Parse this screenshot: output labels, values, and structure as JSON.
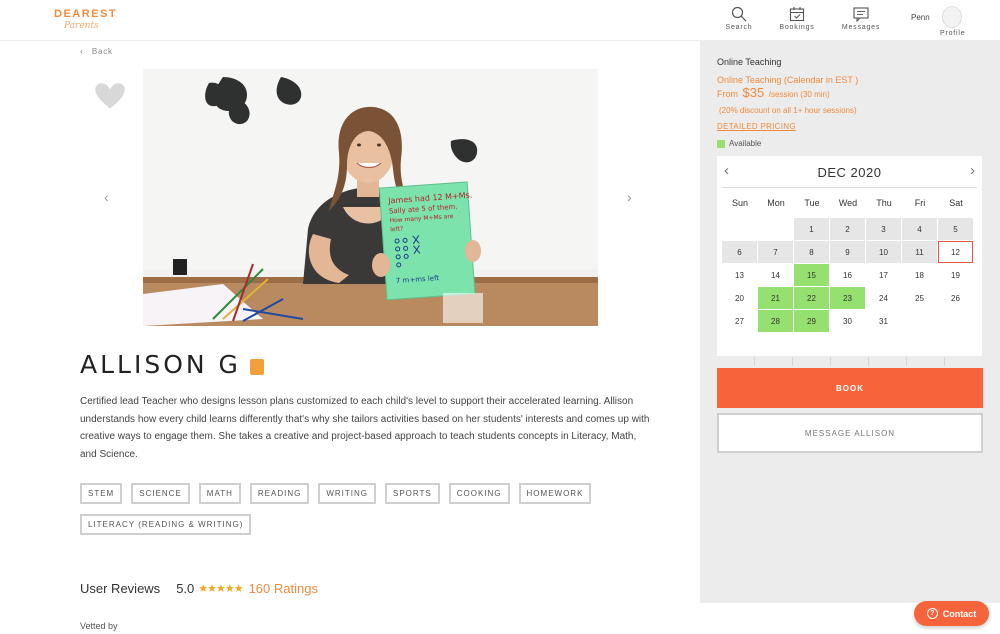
{
  "header": {
    "logo_main": "DEAREST",
    "logo_sub": "Parents",
    "nav": [
      {
        "label": "Search",
        "icon": "search-icon"
      },
      {
        "label": "Bookings",
        "icon": "calendar-icon"
      },
      {
        "label": "Messages",
        "icon": "chat-icon"
      }
    ],
    "user_name": "Penn",
    "profile_label": "Profile"
  },
  "main": {
    "back_label": "Back",
    "teacher_name": "ALLISON G",
    "bio": "Certified lead Teacher who designs lesson plans customized to each child's level to support their accelerated learning. Allison understands how every child learns differently that's why she tailors activities based on her students' interests and comes up with creative ways to engage them. She takes a creative and project-based approach to teach students concepts in Literacy, Math, and Science.",
    "tags": [
      "STEM",
      "SCIENCE",
      "MATH",
      "READING",
      "WRITING",
      "SPORTS",
      "COOKING",
      "HOMEWORK",
      "LITERACY (READING & WRITING)"
    ],
    "reviews": {
      "title": "User Reviews",
      "rating": "5.0",
      "stars": "★★★★★",
      "count": "160 Ratings"
    },
    "vetted_label": "Vetted by",
    "photo_whiteboard_text": [
      "James had 12 M+Ms.",
      "Sally ate 5 of them.",
      "How many M+Ms are",
      "left?",
      "7 m+ms left"
    ]
  },
  "sidebar": {
    "title": "Online Teaching",
    "calendar_note": "Online Teaching (Calendar in EST )",
    "price_from": "From",
    "price_amount": "$35",
    "price_per": "/session (30 min)",
    "discount": "(20% discount on all 1+ hour sessions)",
    "pricing_link": "DETAILED PRICING",
    "legend_label": "Available",
    "calendar": {
      "month": "DEC 2020",
      "weekdays": [
        "Sun",
        "Mon",
        "Tue",
        "Wed",
        "Thu",
        "Fri",
        "Sat"
      ],
      "days": [
        {
          "d": "",
          "s": "empty"
        },
        {
          "d": "",
          "s": "empty"
        },
        {
          "d": "1",
          "s": "past"
        },
        {
          "d": "2",
          "s": "past"
        },
        {
          "d": "3",
          "s": "past"
        },
        {
          "d": "4",
          "s": "past"
        },
        {
          "d": "5",
          "s": "past"
        },
        {
          "d": "6",
          "s": "past"
        },
        {
          "d": "7",
          "s": "past"
        },
        {
          "d": "8",
          "s": "past"
        },
        {
          "d": "9",
          "s": "past"
        },
        {
          "d": "10",
          "s": "past"
        },
        {
          "d": "11",
          "s": "past"
        },
        {
          "d": "12",
          "s": "today"
        },
        {
          "d": "13",
          "s": ""
        },
        {
          "d": "14",
          "s": ""
        },
        {
          "d": "15",
          "s": "avail"
        },
        {
          "d": "16",
          "s": ""
        },
        {
          "d": "17",
          "s": ""
        },
        {
          "d": "18",
          "s": ""
        },
        {
          "d": "19",
          "s": ""
        },
        {
          "d": "20",
          "s": ""
        },
        {
          "d": "21",
          "s": "avail"
        },
        {
          "d": "22",
          "s": "avail"
        },
        {
          "d": "23",
          "s": "avail"
        },
        {
          "d": "24",
          "s": ""
        },
        {
          "d": "25",
          "s": ""
        },
        {
          "d": "26",
          "s": ""
        },
        {
          "d": "27",
          "s": ""
        },
        {
          "d": "28",
          "s": "avail"
        },
        {
          "d": "29",
          "s": "avail"
        },
        {
          "d": "30",
          "s": ""
        },
        {
          "d": "31",
          "s": ""
        },
        {
          "d": "",
          "s": "empty"
        },
        {
          "d": "",
          "s": "empty"
        }
      ]
    },
    "book_label": "BOOK",
    "message_label": "MESSAGE ALLISON"
  },
  "contact_label": "Contact",
  "colors": {
    "accent_orange": "#f08a3c",
    "book_button": "#f6643b",
    "available_green": "#95e06e",
    "sidebar_bg": "#ececec"
  }
}
